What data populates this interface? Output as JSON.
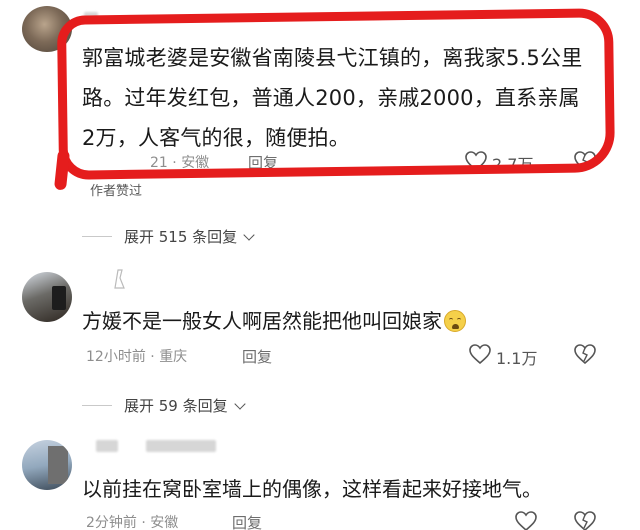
{
  "comments": [
    {
      "text": "郭富城老婆是安徽省南陵县弋江镇的，离我家5.5公里路。过年发红包，普通人200，亲戚2000，直系亲属2万，人客气的很，随便拍。",
      "time": "21",
      "location": "安徽",
      "reply_label": "回复",
      "like_count": "2.7万",
      "liked_by_author": "作者赞过",
      "expand_label": "展开 515 条回复"
    },
    {
      "text": "方媛不是一般女人啊居然能把他叫回娘家",
      "time": "12小时前",
      "location": "重庆",
      "reply_label": "回复",
      "like_count": "1.1万",
      "expand_label": "展开 59 条回复"
    },
    {
      "text": "以前挂在窝卧室墙上的偶像，这样看起来好接地气。",
      "time": "2分钟前",
      "location": "安徽",
      "reply_label": "回复"
    }
  ],
  "separator": "·",
  "highlight_color": "#e51d1d",
  "icons": [
    "heart-outline-icon",
    "dislike-heart-icon",
    "chevron-down-icon",
    "laughing-emoji-icon"
  ]
}
